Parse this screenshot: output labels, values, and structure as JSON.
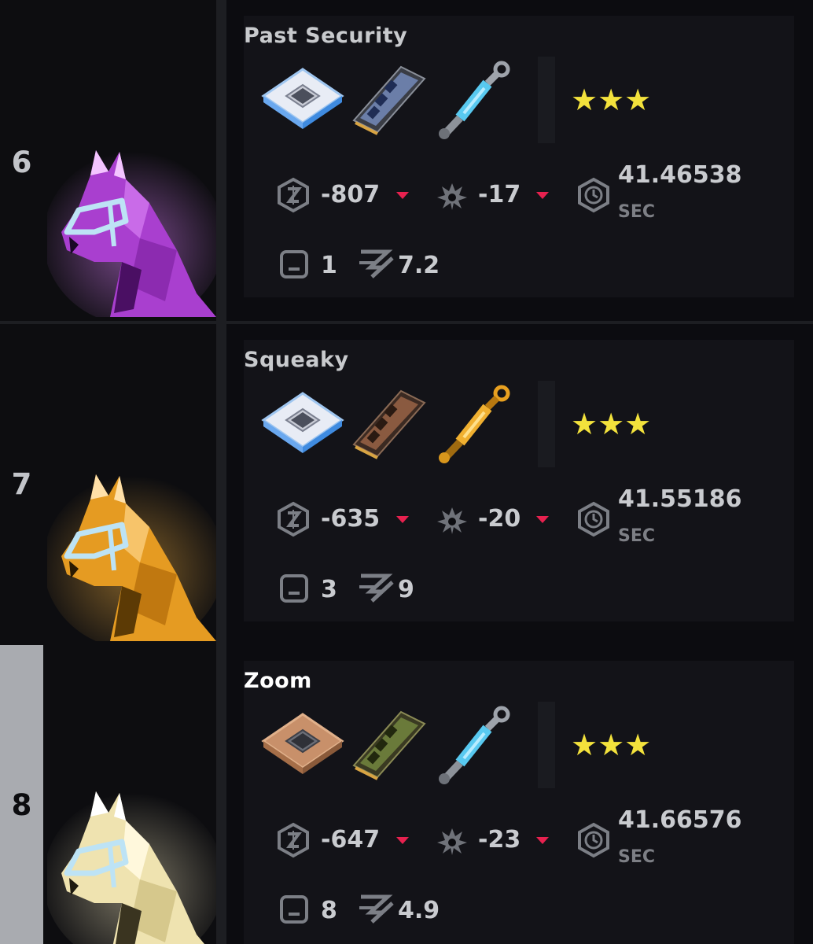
{
  "rows": [
    {
      "position": "6",
      "name": "Past Security",
      "horse_color": "#b848e0",
      "parts": [
        "chip-silver-icon",
        "ram-blue-icon",
        "shock-blue-icon"
      ],
      "rating_stars": 3,
      "stars_text": "★★★",
      "stat1": "-807",
      "stat2": "-17",
      "time": "41.46538",
      "time_unit": "SEC",
      "count": "1",
      "z_value": "7.2"
    },
    {
      "position": "7",
      "name": "Squeaky",
      "horse_color": "#f0a124",
      "parts": [
        "chip-silver-icon",
        "ram-copper-icon",
        "shock-gold-icon"
      ],
      "rating_stars": 3,
      "stars_text": "★★★",
      "stat1": "-635",
      "stat2": "-20",
      "time": "41.55186",
      "time_unit": "SEC",
      "count": "3",
      "z_value": "9"
    },
    {
      "position": "8",
      "name": "Zoom",
      "horse_color": "#f6eecb",
      "parts": [
        "chip-bronze-icon",
        "ram-gold-icon",
        "shock-blue-icon"
      ],
      "rating_stars": 3,
      "stars_text": "★★★",
      "stat1": "-647",
      "stat2": "-23",
      "time": "41.66576",
      "time_unit": "SEC",
      "count": "8",
      "z_value": "4.9"
    }
  ],
  "colors": {
    "star": "#f3e23c",
    "down_arrow": "#e7214f",
    "highlight_stripe": "#a9abb0"
  }
}
